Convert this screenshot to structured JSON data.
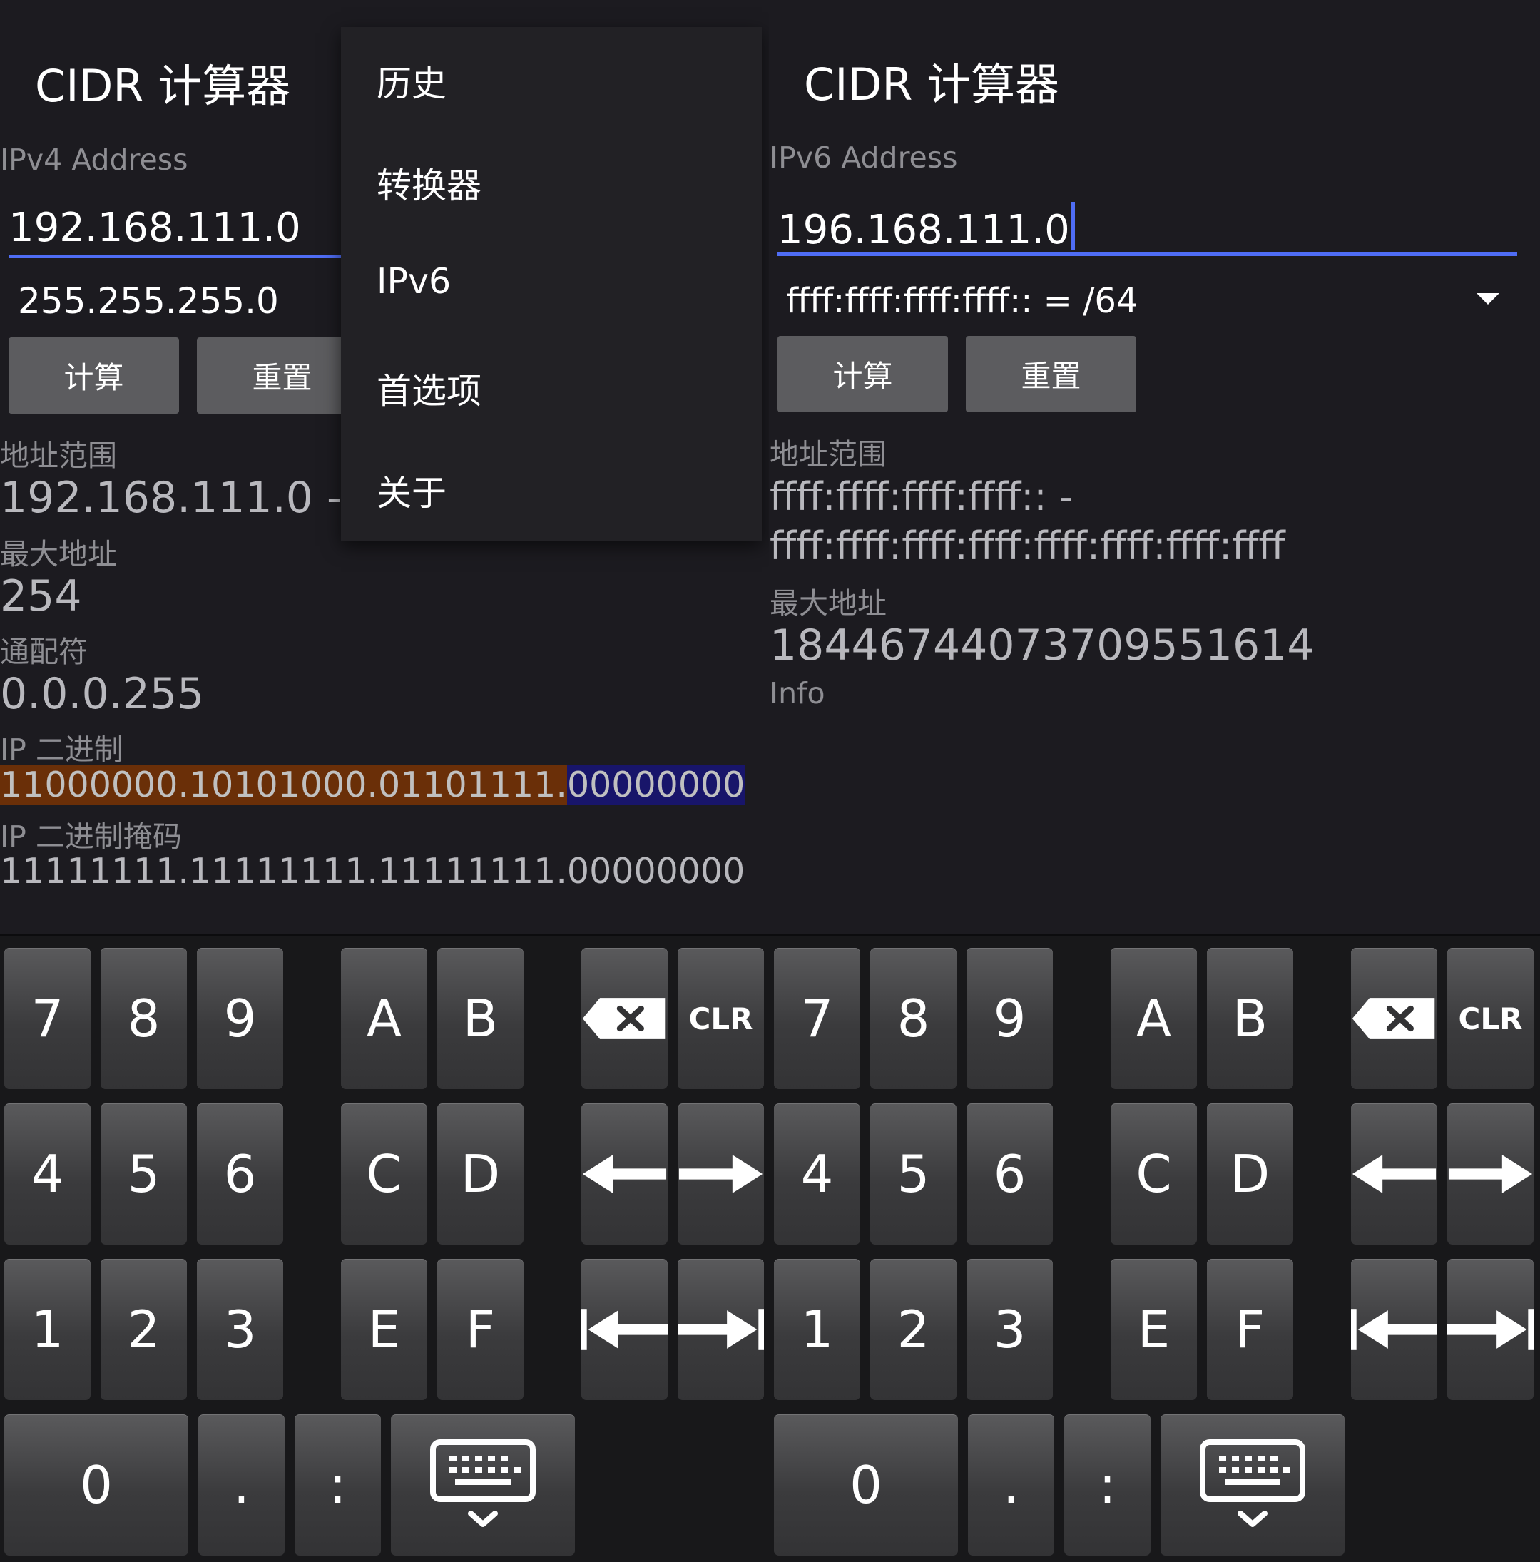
{
  "left": {
    "app_title": "CIDR 计算器",
    "ip_label": "IPv4 Address",
    "ip_value": "192.168.111.0",
    "mask_value": "255.255.255.0",
    "calc_label": "计算",
    "reset_label": "重置",
    "range_label": "地址范围",
    "range_value": "192.168.111.0 - 1",
    "max_label": "最大地址",
    "max_value": "254",
    "wildcard_label": "通配符",
    "wildcard_value": "0.0.0.255",
    "binary_label": "IP 二进制",
    "binary_network": "11000000.10101000.01101111.",
    "binary_host": "00000000",
    "binary_mask_label": "IP 二进制掩码",
    "binary_mask_value": "11111111.11111111.11111111.00000000"
  },
  "menu": {
    "items": [
      "历史",
      "转换器",
      "IPv6",
      "首选项",
      "关于"
    ]
  },
  "right": {
    "app_title": "CIDR 计算器",
    "ip_label": "IPv6 Address",
    "ip_value": "196.168.111.0",
    "prefix_value": "ffff:ffff:ffff:ffff:: = /64",
    "calc_label": "计算",
    "reset_label": "重置",
    "range_label": "地址范围",
    "range_line1": "ffff:ffff:ffff:ffff:: -",
    "range_line2": "ffff:ffff:ffff:ffff:ffff:ffff:ffff:ffff",
    "max_label": "最大地址",
    "max_value": "18446744073709551614",
    "info_label": "Info"
  },
  "keyboard": {
    "digits_row1": [
      "7",
      "8",
      "9"
    ],
    "digits_row2": [
      "4",
      "5",
      "6"
    ],
    "digits_row3": [
      "1",
      "2",
      "3"
    ],
    "hex_row1": [
      "A",
      "B"
    ],
    "hex_row2": [
      "C",
      "D"
    ],
    "hex_row3": [
      "E",
      "F"
    ],
    "zero": "0",
    "dot": ".",
    "colon": ":",
    "clear": "CLR"
  },
  "colors": {
    "background": "#1c1b20",
    "accent": "#4f6df5",
    "button": "#5c5c5f",
    "binary_network_highlight": "#6a2f08",
    "binary_host_highlight": "#18156a"
  }
}
